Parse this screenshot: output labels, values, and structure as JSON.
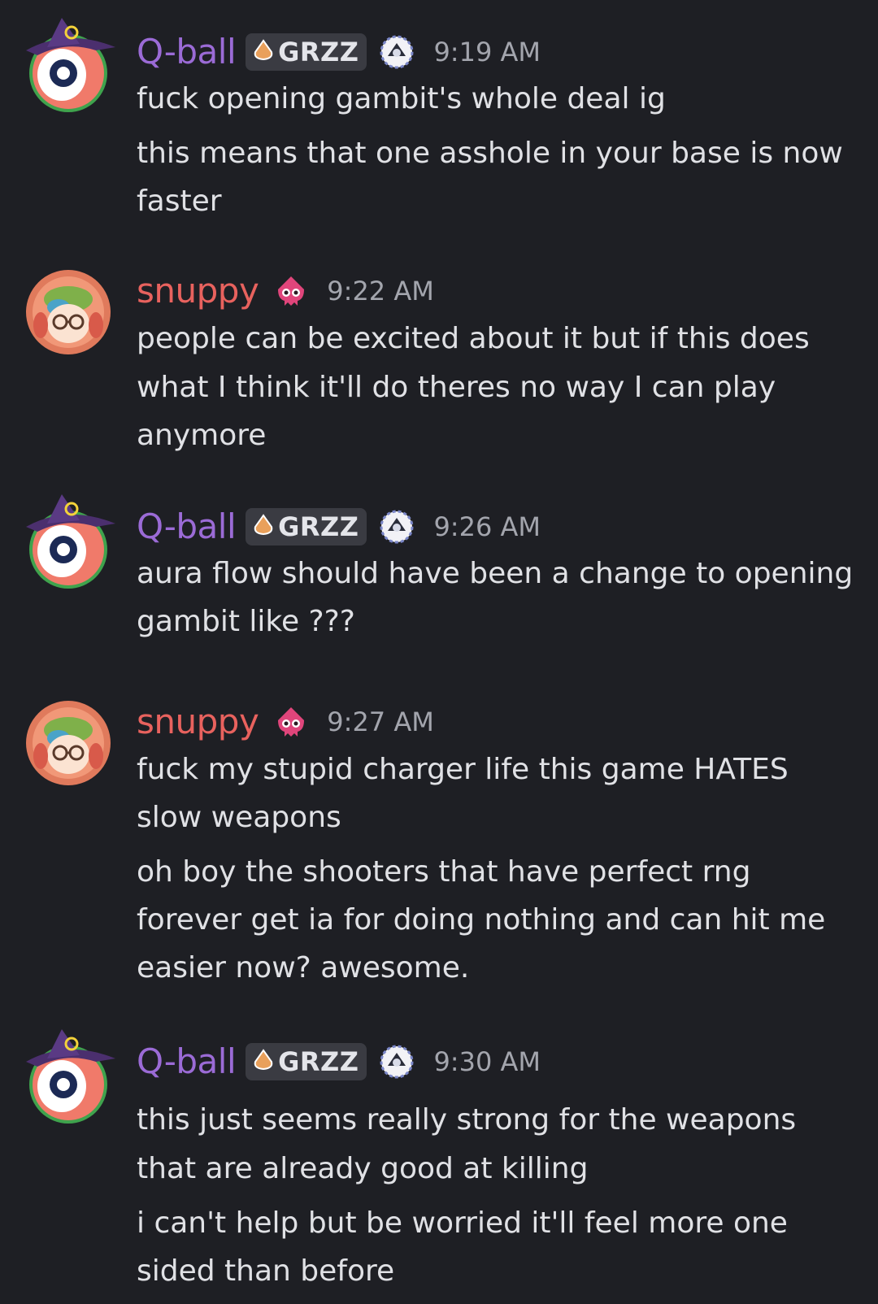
{
  "users": {
    "qball": {
      "name": "Q-ball",
      "tag": "GRZZ",
      "color": "#9b6bd6"
    },
    "snuppy": {
      "name": "snuppy",
      "color": "#e8625e"
    }
  },
  "colors": {
    "background": "#1e1f24",
    "text": "#e0e1e5",
    "timestamp": "#a3a5ad",
    "tag_bg": "#3a3b42"
  },
  "messages": [
    {
      "author": "Q-ball",
      "tag": "GRZZ",
      "time": "9:19 AM",
      "lines": [
        "fuck opening gambit's whole deal ig",
        "this means that one asshole in your base is now",
        "faster"
      ]
    },
    {
      "author": "snuppy",
      "time": "9:22 AM",
      "lines": [
        "people can be excited about it but if this does",
        "what I think it'll  do theres no way I can play",
        "anymore"
      ]
    },
    {
      "author": "Q-ball",
      "tag": "GRZZ",
      "time": "9:26 AM",
      "lines": [
        "aura flow should have been a change to opening",
        "gambit like ???"
      ]
    },
    {
      "author": "snuppy",
      "time": "9:27 AM",
      "lines": [
        "fuck my stupid charger life this game HATES",
        "slow weapons",
        "oh boy the shooters that have perfect rng",
        "forever get ia for doing nothing and can hit me",
        "easier now? awesome."
      ]
    },
    {
      "author": "Q-ball",
      "tag": "GRZZ",
      "time": "9:30 AM",
      "lines": [
        "this just seems really strong for the weapons",
        "that are already good at killing",
        "i can't help but be worried it'll feel more one",
        "sided than before"
      ]
    }
  ]
}
